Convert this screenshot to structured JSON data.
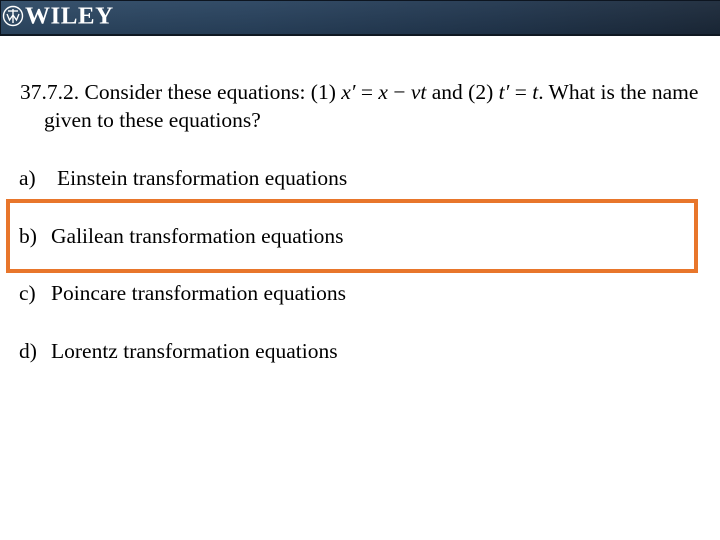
{
  "header": {
    "brand": "WILEY",
    "logo_icon": "wiley-emblem-icon",
    "colors": {
      "bar_left": "#2f4b67",
      "bar_right": "#1c2a3b",
      "text": "#ffffff"
    }
  },
  "question": {
    "number": "37.7.2.",
    "text_before": " Consider these equations: (1) ",
    "eq1_lhs": "x′",
    "eq1_mid": " = ",
    "eq1_x": "x",
    "eq1_minus": " − ",
    "eq1_vt": "vt",
    "text_middle": " and (2) ",
    "eq2_lhs": "t′",
    "eq2_mid": " = ",
    "eq2_rhs": "t",
    "text_after": ".  What is the name given to these equations?"
  },
  "options": [
    {
      "letter": "a)",
      "label": "Einstein transformation equations",
      "highlighted": false
    },
    {
      "letter": "b)",
      "label": "Galilean transformation equations",
      "highlighted": true
    },
    {
      "letter": "c)",
      "label": "Poincare transformation equations",
      "highlighted": false
    },
    {
      "letter": "d)",
      "label": "Lorentz transformation equations",
      "highlighted": false
    }
  ],
  "highlight": {
    "color": "#e8762b",
    "selected_option": "b)"
  }
}
